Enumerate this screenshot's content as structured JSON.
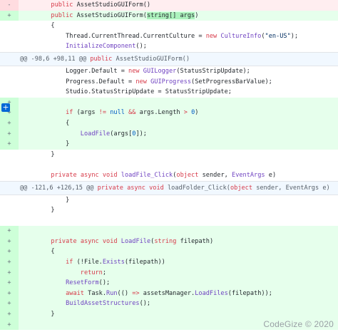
{
  "lines": [
    {
      "type": "del",
      "sign": "-",
      "parts": [
        {
          "t": "        "
        },
        {
          "t": "public",
          "c": "kw"
        },
        {
          "t": " AssetStudioGUIForm()"
        }
      ]
    },
    {
      "type": "add",
      "sign": "+",
      "parts": [
        {
          "t": "        "
        },
        {
          "t": "public",
          "c": "kw"
        },
        {
          "t": " AssetStudioGUIForm("
        },
        {
          "t": "string[] args",
          "c": "hl"
        },
        {
          "t": ")"
        }
      ]
    },
    {
      "type": "ctx",
      "sign": "",
      "parts": [
        {
          "t": "        {"
        }
      ]
    },
    {
      "type": "ctx",
      "sign": "",
      "parts": [
        {
          "t": "            Thread.CurrentThread.CurrentCulture = "
        },
        {
          "t": "new",
          "c": "kw"
        },
        {
          "t": " "
        },
        {
          "t": "CultureInfo",
          "c": "fn"
        },
        {
          "t": "("
        },
        {
          "t": "\"en-US\"",
          "c": "str"
        },
        {
          "t": ");"
        }
      ]
    },
    {
      "type": "ctx",
      "sign": "",
      "parts": [
        {
          "t": "            "
        },
        {
          "t": "InitializeComponent",
          "c": "fn"
        },
        {
          "t": "();"
        }
      ]
    },
    {
      "type": "hunk",
      "sign": "",
      "parts": [
        {
          "t": "@@ -98,6 +98,11 @@ "
        },
        {
          "t": "public",
          "c": "kw"
        },
        {
          "t": " AssetStudioGUIForm()"
        }
      ]
    },
    {
      "type": "ctx",
      "sign": "",
      "parts": [
        {
          "t": "            Logger.Default = "
        },
        {
          "t": "new",
          "c": "kw"
        },
        {
          "t": " "
        },
        {
          "t": "GUILogger",
          "c": "fn"
        },
        {
          "t": "(StatusStripUpdate);"
        }
      ]
    },
    {
      "type": "ctx",
      "sign": "",
      "parts": [
        {
          "t": "            Progress.Default = "
        },
        {
          "t": "new",
          "c": "kw"
        },
        {
          "t": " "
        },
        {
          "t": "GUIProgress",
          "c": "fn"
        },
        {
          "t": "(SetProgressBarValue);"
        }
      ]
    },
    {
      "type": "ctx",
      "sign": "",
      "parts": [
        {
          "t": "            Studio.StatusStripUpdate = StatusStripUpdate;"
        }
      ]
    },
    {
      "type": "add",
      "sign": "+",
      "parts": [
        {
          "t": ""
        }
      ]
    },
    {
      "type": "add",
      "sign": "+",
      "parts": [
        {
          "t": "            "
        },
        {
          "t": "if",
          "c": "kw"
        },
        {
          "t": " (args "
        },
        {
          "t": "!=",
          "c": "kw"
        },
        {
          "t": " "
        },
        {
          "t": "null",
          "c": "ty"
        },
        {
          "t": " "
        },
        {
          "t": "&&",
          "c": "kw"
        },
        {
          "t": " args.Length "
        },
        {
          "t": ">",
          "c": "kw"
        },
        {
          "t": " "
        },
        {
          "t": "0",
          "c": "ty"
        },
        {
          "t": ")"
        }
      ]
    },
    {
      "type": "add",
      "sign": "+",
      "parts": [
        {
          "t": "            {"
        }
      ]
    },
    {
      "type": "add",
      "sign": "+",
      "parts": [
        {
          "t": "                "
        },
        {
          "t": "LoadFile",
          "c": "fn"
        },
        {
          "t": "(args["
        },
        {
          "t": "0",
          "c": "ty"
        },
        {
          "t": "]);"
        }
      ]
    },
    {
      "type": "add",
      "sign": "+",
      "parts": [
        {
          "t": "            }"
        }
      ]
    },
    {
      "type": "ctx",
      "sign": "",
      "parts": [
        {
          "t": "        }"
        }
      ]
    },
    {
      "type": "ctx",
      "sign": "",
      "parts": [
        {
          "t": ""
        }
      ]
    },
    {
      "type": "ctx",
      "sign": "",
      "parts": [
        {
          "t": "        "
        },
        {
          "t": "private",
          "c": "kw"
        },
        {
          "t": " "
        },
        {
          "t": "async",
          "c": "kw"
        },
        {
          "t": " "
        },
        {
          "t": "void",
          "c": "kw"
        },
        {
          "t": " "
        },
        {
          "t": "loadFile_Click",
          "c": "fn"
        },
        {
          "t": "("
        },
        {
          "t": "object",
          "c": "kw"
        },
        {
          "t": " sender, "
        },
        {
          "t": "EventArgs",
          "c": "fn"
        },
        {
          "t": " e)"
        }
      ]
    },
    {
      "type": "hunk",
      "sign": "",
      "parts": [
        {
          "t": "@@ -121,6 +126,15 @@ "
        },
        {
          "t": "private",
          "c": "kw"
        },
        {
          "t": " "
        },
        {
          "t": "async",
          "c": "kw"
        },
        {
          "t": " "
        },
        {
          "t": "void",
          "c": "kw"
        },
        {
          "t": " loadFolder_Click("
        },
        {
          "t": "object",
          "c": "kw"
        },
        {
          "t": " sender, EventArgs e)"
        }
      ]
    },
    {
      "type": "ctx",
      "sign": "",
      "parts": [
        {
          "t": "            }"
        }
      ]
    },
    {
      "type": "ctx",
      "sign": "",
      "parts": [
        {
          "t": "        }"
        }
      ]
    },
    {
      "type": "ctx",
      "sign": "",
      "parts": [
        {
          "t": ""
        }
      ]
    },
    {
      "type": "add",
      "sign": "+",
      "parts": [
        {
          "t": ""
        }
      ]
    },
    {
      "type": "add",
      "sign": "+",
      "parts": [
        {
          "t": "        "
        },
        {
          "t": "private",
          "c": "kw"
        },
        {
          "t": " "
        },
        {
          "t": "async",
          "c": "kw"
        },
        {
          "t": " "
        },
        {
          "t": "void",
          "c": "kw"
        },
        {
          "t": " "
        },
        {
          "t": "LoadFile",
          "c": "fn"
        },
        {
          "t": "("
        },
        {
          "t": "string",
          "c": "kw"
        },
        {
          "t": " filepath)"
        }
      ]
    },
    {
      "type": "add",
      "sign": "+",
      "parts": [
        {
          "t": "        {"
        }
      ]
    },
    {
      "type": "add",
      "sign": "+",
      "parts": [
        {
          "t": "            "
        },
        {
          "t": "if",
          "c": "kw"
        },
        {
          "t": " (!File."
        },
        {
          "t": "Exists",
          "c": "fn"
        },
        {
          "t": "(filepath))"
        }
      ]
    },
    {
      "type": "add",
      "sign": "+",
      "parts": [
        {
          "t": "                "
        },
        {
          "t": "return",
          "c": "kw"
        },
        {
          "t": ";"
        }
      ]
    },
    {
      "type": "add",
      "sign": "+",
      "parts": [
        {
          "t": "            "
        },
        {
          "t": "ResetForm",
          "c": "fn"
        },
        {
          "t": "();"
        }
      ]
    },
    {
      "type": "add",
      "sign": "+",
      "parts": [
        {
          "t": "            "
        },
        {
          "t": "await",
          "c": "kw"
        },
        {
          "t": " Task."
        },
        {
          "t": "Run",
          "c": "fn"
        },
        {
          "t": "(() "
        },
        {
          "t": "=>",
          "c": "kw"
        },
        {
          "t": " assetsManager."
        },
        {
          "t": "LoadFiles",
          "c": "fn"
        },
        {
          "t": "(filepath));"
        }
      ]
    },
    {
      "type": "add",
      "sign": "+",
      "parts": [
        {
          "t": "            "
        },
        {
          "t": "BuildAssetStructures",
          "c": "fn"
        },
        {
          "t": "();"
        }
      ]
    },
    {
      "type": "add",
      "sign": "+",
      "parts": [
        {
          "t": "        }"
        }
      ]
    },
    {
      "type": "add",
      "sign": "+",
      "parts": [
        {
          "t": ""
        }
      ]
    }
  ],
  "expand_icon": "plus-icon",
  "expand_symbol": "+",
  "watermark": "CodeGize © 2020"
}
